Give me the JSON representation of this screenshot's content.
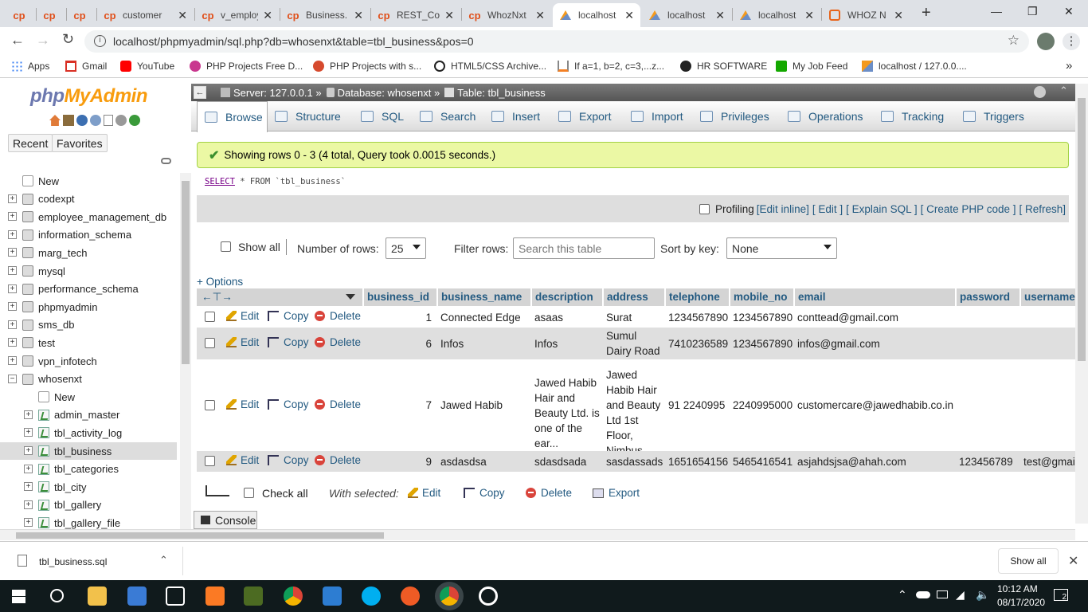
{
  "browser": {
    "tabs": [
      {
        "title": "",
        "favicon": "cp"
      },
      {
        "title": "",
        "favicon": "cp"
      },
      {
        "title": "",
        "favicon": "cp"
      },
      {
        "title": "customer",
        "favicon": "cp"
      },
      {
        "title": "v_employ",
        "favicon": "cp"
      },
      {
        "title": "Business.",
        "favicon": "cp"
      },
      {
        "title": "REST_Co",
        "favicon": "cp"
      },
      {
        "title": "WhozNxt",
        "favicon": "cp"
      },
      {
        "title": "localhost",
        "favicon": "pma",
        "active": true
      },
      {
        "title": "localhost",
        "favicon": "pma"
      },
      {
        "title": "localhost",
        "favicon": "pma"
      },
      {
        "title": "WHOZ N",
        "favicon": "xampp"
      }
    ],
    "new_tab": "+",
    "url": "localhost/phpmyadmin/sql.php?db=whosenxt&table=tbl_business&pos=0",
    "bookmarks": [
      "Apps",
      "Gmail",
      "YouTube",
      "PHP Projects Free D...",
      "PHP Projects with s...",
      "HTML5/CSS Archive...",
      "If a=1, b=2, c=3,...z...",
      "HR SOFTWARE",
      "My Job Feed",
      "localhost / 127.0.0...."
    ],
    "bookmarks_more": "»"
  },
  "pma": {
    "logo_php": "php",
    "logo_myadmin": "MyAdmin",
    "nav_tabs": [
      "Recent",
      "Favorites"
    ],
    "tree": [
      {
        "label": "New",
        "type": "new"
      },
      {
        "label": "codexpt",
        "type": "db"
      },
      {
        "label": "employee_management_db",
        "type": "db"
      },
      {
        "label": "information_schema",
        "type": "db"
      },
      {
        "label": "marg_tech",
        "type": "db"
      },
      {
        "label": "mysql",
        "type": "db"
      },
      {
        "label": "performance_schema",
        "type": "db"
      },
      {
        "label": "phpmyadmin",
        "type": "db"
      },
      {
        "label": "sms_db",
        "type": "db"
      },
      {
        "label": "test",
        "type": "db"
      },
      {
        "label": "vpn_infotech",
        "type": "db"
      },
      {
        "label": "whosenxt",
        "type": "db",
        "expanded": true
      },
      {
        "label": "New",
        "type": "new-sub"
      },
      {
        "label": "admin_master",
        "type": "table"
      },
      {
        "label": "tbl_activity_log",
        "type": "table"
      },
      {
        "label": "tbl_business",
        "type": "table",
        "selected": true
      },
      {
        "label": "tbl_categories",
        "type": "table"
      },
      {
        "label": "tbl_city",
        "type": "table"
      },
      {
        "label": "tbl_gallery",
        "type": "table"
      },
      {
        "label": "tbl_gallery_file",
        "type": "table"
      }
    ],
    "breadcrumb": {
      "server": "Server: 127.0.0.1 »",
      "database": "Database: whosenxt »",
      "table": "Table: tbl_business"
    },
    "menu": [
      "Browse",
      "Structure",
      "SQL",
      "Search",
      "Insert",
      "Export",
      "Import",
      "Privileges",
      "Operations",
      "Tracking",
      "Triggers"
    ],
    "success_message": "Showing rows 0 - 3 (4 total, Query took 0.0015 seconds.)",
    "sql_select": "SELECT",
    "sql_rest": " * FROM `tbl_business`",
    "profiling": {
      "label": "Profiling",
      "links": [
        "[Edit inline]",
        "[ Edit ]",
        "[ Explain SQL ]",
        "[ Create PHP code ]",
        "[ Refresh]"
      ]
    },
    "controls": {
      "show_all": "Show all",
      "rows_label": "Number of rows:",
      "rows_value": "25",
      "filter_label": "Filter rows:",
      "filter_placeholder": "Search this table",
      "sort_label": "Sort by key:",
      "sort_value": "None"
    },
    "options": "+ Options",
    "columns": [
      "business_id",
      "business_name",
      "description",
      "address",
      "telephone",
      "mobile_no",
      "email",
      "password",
      "username"
    ],
    "row_actions": {
      "edit": "Edit",
      "copy": "Copy",
      "delete": "Delete"
    },
    "rows": [
      {
        "business_id": "1",
        "business_name": "Connected Edge",
        "description": "asaas",
        "address": "Surat",
        "telephone": "1234567890",
        "mobile_no": "1234567890",
        "email": "conttead@gmail.com",
        "password": "",
        "username": ""
      },
      {
        "business_id": "6",
        "business_name": "Infos",
        "description": "Infos",
        "address": "Sumul Dairy Road",
        "telephone": "7410236589",
        "mobile_no": "1234567890",
        "email": "infos@gmail.com",
        "password": "",
        "username": ""
      },
      {
        "business_id": "7",
        "business_name": "Jawed Habib",
        "description": "Jawed Habib Hair and Beauty Ltd. is one of the ear...",
        "address": "Jawed Habib Hair and Beauty Ltd 1st Floor, Nimbus ...",
        "telephone": "91 2240995",
        "mobile_no": "2240995000",
        "email": "customercare@jawedhabib.co.in",
        "password": "",
        "username": ""
      },
      {
        "business_id": "9",
        "business_name": "asdasdsa",
        "description": "sdasdsada",
        "address": "sasdassads",
        "telephone": "1651654156",
        "mobile_no": "5465416541",
        "email": "asjahdsjsa@ahah.com",
        "password": "123456789",
        "username": "test@gmai"
      }
    ],
    "footer": {
      "check_all": "Check all",
      "with_selected": "With selected:",
      "edit": "Edit",
      "copy": "Copy",
      "delete": "Delete",
      "export": "Export"
    },
    "console": "Console"
  },
  "downloads": {
    "file": "tbl_business.sql",
    "show_all": "Show all"
  },
  "taskbar": {
    "time": "10:12 AM",
    "date": "08/17/2020",
    "notifications": "2"
  }
}
